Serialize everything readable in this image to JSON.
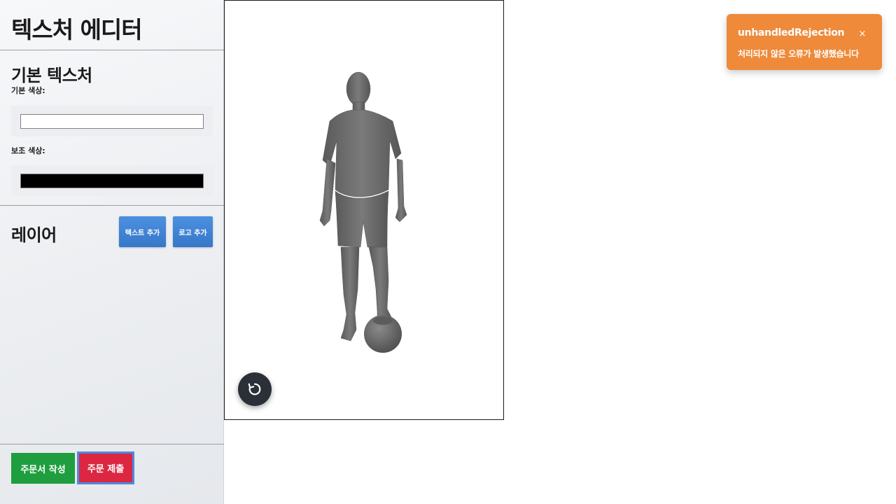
{
  "sidebar": {
    "app_title": "텍스처 에디터",
    "base_texture": {
      "title": "기본 텍스처",
      "primary_color_label": "기본 색상:",
      "primary_color": "#ffffff",
      "secondary_color_label": "보조 색상:",
      "secondary_color": "#000000"
    },
    "layers": {
      "title": "레이어",
      "add_text_label": "텍스트 추가",
      "add_logo_label": "로고 추가"
    },
    "footer": {
      "write_order_label": "주문서 작성",
      "submit_order_label": "주문 제출"
    }
  },
  "viewer": {
    "model_subject": "soccer-player-with-ball",
    "reset_icon": "rotate-reset-icon"
  },
  "toast": {
    "title": "unhandledRejection",
    "message": "처리되지 않은 오류가 발생했습니다",
    "close_label": "×"
  },
  "colors": {
    "primary_blue": "#3577c9",
    "green": "#1e9e3e",
    "red": "#dc2742",
    "toast_orange": "#ee8a3a",
    "model_gray": "#6b6b6b"
  }
}
